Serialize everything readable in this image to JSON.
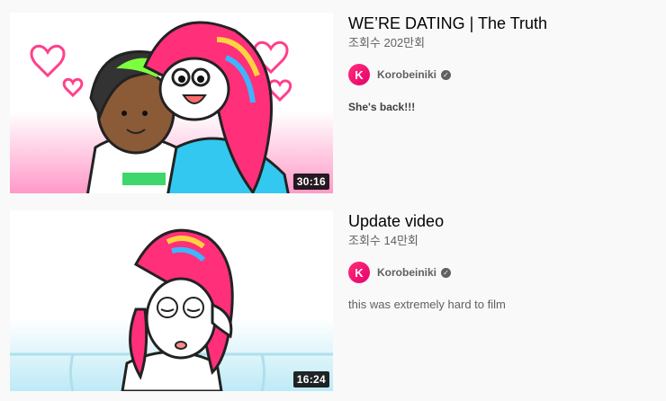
{
  "videos": [
    {
      "title": "WE’RE DATING | The Truth",
      "views": "조회수 202만회",
      "channel": "Korobeiniki",
      "channel_initial": "K",
      "description": "She's back!!!",
      "duration": "30:16"
    },
    {
      "title": "Update video",
      "views": "조회수 14만회",
      "channel": "Korobeiniki",
      "channel_initial": "K",
      "description": "this was extremely hard to film",
      "duration": "16:24"
    }
  ],
  "icons": {
    "verified": "verified-check-icon",
    "avatar": "channel-avatar"
  },
  "colors": {
    "background": "#f9f9f9",
    "title": "#030303",
    "secondary": "#606060",
    "avatar": "#ff2f7a"
  }
}
